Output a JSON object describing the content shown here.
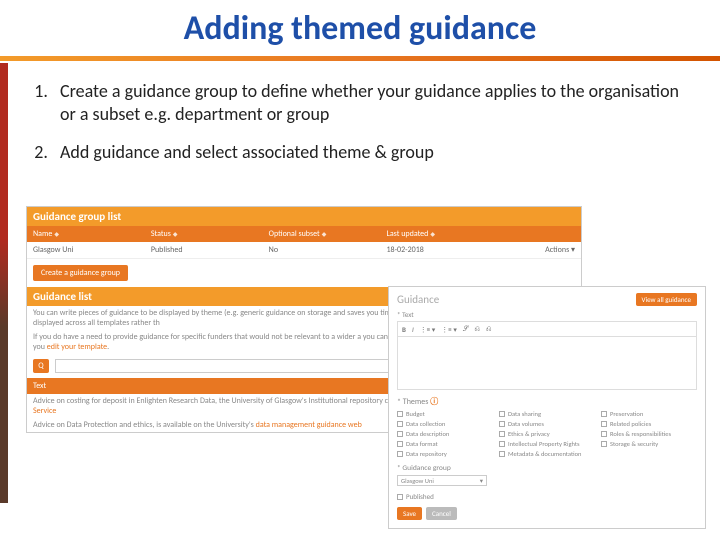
{
  "slide": {
    "title": "Adding themed guidance",
    "steps": [
      "Create a guidance group to define whether your guidance applies to the organisation or a subset e.g. department or group",
      "Add guidance and select associated theme & group"
    ]
  },
  "panel1": {
    "header1": "Guidance group list",
    "columns": [
      "Name",
      "Status",
      "Optional subset",
      "Last updated",
      ""
    ],
    "row": {
      "name": "Glasgow Uni",
      "status": "Published",
      "subset": "No",
      "updated": "18-02-2018",
      "actions": "Actions ▾"
    },
    "create_btn": "Create a guidance group",
    "header2": "Guidance list",
    "para1": "You can write pieces of guidance to be displayed by theme (e.g. generic guidance on storage and saves you time and effort as your advice will be automatically displayed across all templates rather th",
    "para2a": "If you do have a need to provide guidance for specific funders that would not be relevant to a wider a you can do so by adding guidance to a specific question when you ",
    "para2_link": "edit your template",
    "search_btn": "Search",
    "text_band": "Text",
    "advice1a": "Advice on costing for deposit in Enlighten Research Data, the University of Glasgow's Institutional repository can be ",
    "advice1_link": "sought from the: Research Data Management Service",
    "advice2a": "Advice on Data Protection and ethics, is available on the University's ",
    "advice2_link": "data management guidance web"
  },
  "panel2": {
    "title": "Guidance",
    "view_btn": "View all guidance",
    "text_label": "* Text",
    "toolbar": [
      "B",
      "I",
      "⋮≡ ▾",
      "⋮≡ ▾",
      "𝒮",
      "⎌",
      "⎌"
    ],
    "themes_label": "* Themes",
    "themes": [
      "Budget",
      "Data sharing",
      "Preservation",
      "Data collection",
      "Data volumes",
      "Related policies",
      "Data description",
      "Ethics & privacy",
      "Roles & responsibilities",
      "Data format",
      "Intellectual Property Rights",
      "Storage & security",
      "Data repository",
      "Metadata & documentation",
      ""
    ],
    "group_label": "* Guidance group",
    "group_value": "Glasgow Uni",
    "published_label": "Published",
    "save_btn": "Save",
    "cancel_btn": "Cancel"
  }
}
